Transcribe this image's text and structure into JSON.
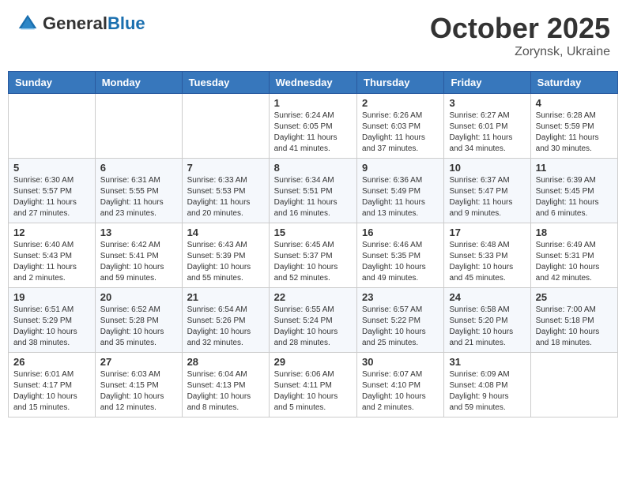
{
  "header": {
    "logo_general": "General",
    "logo_blue": "Blue",
    "month": "October 2025",
    "location": "Zorynsk, Ukraine"
  },
  "weekdays": [
    "Sunday",
    "Monday",
    "Tuesday",
    "Wednesday",
    "Thursday",
    "Friday",
    "Saturday"
  ],
  "weeks": [
    [
      {
        "day": "",
        "info": ""
      },
      {
        "day": "",
        "info": ""
      },
      {
        "day": "",
        "info": ""
      },
      {
        "day": "1",
        "info": "Sunrise: 6:24 AM\nSunset: 6:05 PM\nDaylight: 11 hours\nand 41 minutes."
      },
      {
        "day": "2",
        "info": "Sunrise: 6:26 AM\nSunset: 6:03 PM\nDaylight: 11 hours\nand 37 minutes."
      },
      {
        "day": "3",
        "info": "Sunrise: 6:27 AM\nSunset: 6:01 PM\nDaylight: 11 hours\nand 34 minutes."
      },
      {
        "day": "4",
        "info": "Sunrise: 6:28 AM\nSunset: 5:59 PM\nDaylight: 11 hours\nand 30 minutes."
      }
    ],
    [
      {
        "day": "5",
        "info": "Sunrise: 6:30 AM\nSunset: 5:57 PM\nDaylight: 11 hours\nand 27 minutes."
      },
      {
        "day": "6",
        "info": "Sunrise: 6:31 AM\nSunset: 5:55 PM\nDaylight: 11 hours\nand 23 minutes."
      },
      {
        "day": "7",
        "info": "Sunrise: 6:33 AM\nSunset: 5:53 PM\nDaylight: 11 hours\nand 20 minutes."
      },
      {
        "day": "8",
        "info": "Sunrise: 6:34 AM\nSunset: 5:51 PM\nDaylight: 11 hours\nand 16 minutes."
      },
      {
        "day": "9",
        "info": "Sunrise: 6:36 AM\nSunset: 5:49 PM\nDaylight: 11 hours\nand 13 minutes."
      },
      {
        "day": "10",
        "info": "Sunrise: 6:37 AM\nSunset: 5:47 PM\nDaylight: 11 hours\nand 9 minutes."
      },
      {
        "day": "11",
        "info": "Sunrise: 6:39 AM\nSunset: 5:45 PM\nDaylight: 11 hours\nand 6 minutes."
      }
    ],
    [
      {
        "day": "12",
        "info": "Sunrise: 6:40 AM\nSunset: 5:43 PM\nDaylight: 11 hours\nand 2 minutes."
      },
      {
        "day": "13",
        "info": "Sunrise: 6:42 AM\nSunset: 5:41 PM\nDaylight: 10 hours\nand 59 minutes."
      },
      {
        "day": "14",
        "info": "Sunrise: 6:43 AM\nSunset: 5:39 PM\nDaylight: 10 hours\nand 55 minutes."
      },
      {
        "day": "15",
        "info": "Sunrise: 6:45 AM\nSunset: 5:37 PM\nDaylight: 10 hours\nand 52 minutes."
      },
      {
        "day": "16",
        "info": "Sunrise: 6:46 AM\nSunset: 5:35 PM\nDaylight: 10 hours\nand 49 minutes."
      },
      {
        "day": "17",
        "info": "Sunrise: 6:48 AM\nSunset: 5:33 PM\nDaylight: 10 hours\nand 45 minutes."
      },
      {
        "day": "18",
        "info": "Sunrise: 6:49 AM\nSunset: 5:31 PM\nDaylight: 10 hours\nand 42 minutes."
      }
    ],
    [
      {
        "day": "19",
        "info": "Sunrise: 6:51 AM\nSunset: 5:29 PM\nDaylight: 10 hours\nand 38 minutes."
      },
      {
        "day": "20",
        "info": "Sunrise: 6:52 AM\nSunset: 5:28 PM\nDaylight: 10 hours\nand 35 minutes."
      },
      {
        "day": "21",
        "info": "Sunrise: 6:54 AM\nSunset: 5:26 PM\nDaylight: 10 hours\nand 32 minutes."
      },
      {
        "day": "22",
        "info": "Sunrise: 6:55 AM\nSunset: 5:24 PM\nDaylight: 10 hours\nand 28 minutes."
      },
      {
        "day": "23",
        "info": "Sunrise: 6:57 AM\nSunset: 5:22 PM\nDaylight: 10 hours\nand 25 minutes."
      },
      {
        "day": "24",
        "info": "Sunrise: 6:58 AM\nSunset: 5:20 PM\nDaylight: 10 hours\nand 21 minutes."
      },
      {
        "day": "25",
        "info": "Sunrise: 7:00 AM\nSunset: 5:18 PM\nDaylight: 10 hours\nand 18 minutes."
      }
    ],
    [
      {
        "day": "26",
        "info": "Sunrise: 6:01 AM\nSunset: 4:17 PM\nDaylight: 10 hours\nand 15 minutes."
      },
      {
        "day": "27",
        "info": "Sunrise: 6:03 AM\nSunset: 4:15 PM\nDaylight: 10 hours\nand 12 minutes."
      },
      {
        "day": "28",
        "info": "Sunrise: 6:04 AM\nSunset: 4:13 PM\nDaylight: 10 hours\nand 8 minutes."
      },
      {
        "day": "29",
        "info": "Sunrise: 6:06 AM\nSunset: 4:11 PM\nDaylight: 10 hours\nand 5 minutes."
      },
      {
        "day": "30",
        "info": "Sunrise: 6:07 AM\nSunset: 4:10 PM\nDaylight: 10 hours\nand 2 minutes."
      },
      {
        "day": "31",
        "info": "Sunrise: 6:09 AM\nSunset: 4:08 PM\nDaylight: 9 hours\nand 59 minutes."
      },
      {
        "day": "",
        "info": ""
      }
    ]
  ]
}
